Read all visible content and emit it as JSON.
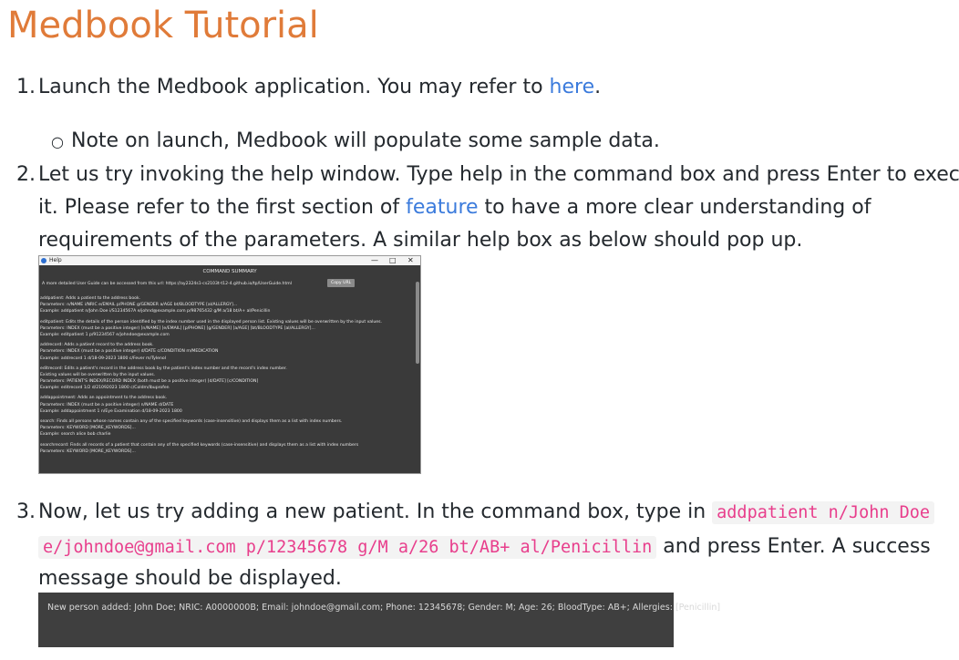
{
  "title": "Medbook Tutorial",
  "steps": {
    "s1": {
      "num": "1.",
      "text_before": "Launch the Medbook application. You may refer to ",
      "link": "here",
      "text_after": ".",
      "bullet": "Note on launch, Medbook will populate some sample data."
    },
    "s2": {
      "num": "2.",
      "line1": "Let us try invoking the help window. Type help in the command box and press Enter to execute",
      "line2_before": "it. Please refer to the first section of ",
      "line2_link": "feature",
      "line2_after": " to have a more clear understanding of",
      "line3": "requirements of the parameters. A similar help box as below should pop up."
    },
    "s3": {
      "num": "3.",
      "line1_text": "Now, let us try adding a new patient. In the command box, type in ",
      "code1": "addpatient n/John Doe",
      "code2": "e/johndoe@gmail.com p/12345678 g/M a/26 bt/AB+ al/Penicillin",
      "line2_after": " and press Enter. A success",
      "line3": "message should be displayed."
    }
  },
  "help_window": {
    "title": "Help",
    "controls": {
      "minimize": "—",
      "maximize": "□",
      "close": "✕"
    },
    "summary": "COMMAND SUMMARY",
    "url_text": "A more detailed User Guide can be accessed from this url: https://ay2324s1-cs2103t-t12-4.github.io/tp/UserGuide.html",
    "copy_button": "Copy URL",
    "lines": [
      "addpatient: Adds a patient to the address book.",
      "Parameters: n/NAME i/NRIC e/EMAIL p/PHONE g/GENDER a/AGE bt/BLOODTYPE [al/ALLERGY]...",
      "Example: addpatient n/John Doe i/S1234567A e/johnd@example.com p/98765432 g/M a/18 bt/A+ al/Penicillin",
      "",
      "editpatient: Edits the details of the person identified by the index number used in the displayed person list. Existing values will be overwritten by the input values.",
      "Parameters: INDEX (must be a positive integer) [n/NAME] [e/EMAIL] [p/PHONE] [g/GENDER] [a/AGE] [bt/BLOODTYPE [al/ALLERGY]...",
      "Example: editpatient 1 p/91234567 e/johndoe@example.com",
      "",
      "addrecord: Adds a patient record to the address book.",
      "Parameters: INDEX (must be a positive integer) d/DATE c/CONDITION m/MEDICATION",
      "Example: addrecord 1 d/18-09-2023 1800 c/Fever m/Tylenol",
      "",
      "editrecord: Edits a patient's record in the address book by the patient's index number and the record's index number.",
      "Existing values will be overwritten by the input values.",
      "Parameters: PATIENT'S INDEX/RECORD INDEX (both must be a positive integer) [d/DATE] [c/CONDITION]",
      "Example: editrecord 1/2 d/21092023 1800 c/Coldm/Ibuprofen",
      "",
      "addappointment: Adds an appointment to the address book.",
      "Parameters: INDEX (must be a positive integer) n/NAME d/DATE",
      "Example: addappointment 1 n/Eye Examination d/18-09-2023 1800",
      "",
      "search: Finds all persons whose names contain any of the specified keywords (case-insensitive) and displays them as a list with index numbers.",
      "Parameters: KEYWORD [MORE_KEYWORDS]...",
      "Example: search alice bob charlie",
      "",
      "searchrecord: Finds all records of a patient that contain any of the specified keywords (case-insensitive) and displays them as a list with index numbers",
      "Parameters: KEYWORD [MORE_KEYWORDS]..."
    ]
  },
  "result_message": "New person added: John Doe; NRIC: A0000000B; Email: johndoe@gmail.com; Phone: 12345678; Gender: M; Age: 26; BloodType: AB+; Allergies: [Penicillin]",
  "colors": {
    "title": "#e07b39",
    "link": "#3b7bdc",
    "code": "#e83e8c",
    "dark_panel": "#3a3a3a"
  }
}
